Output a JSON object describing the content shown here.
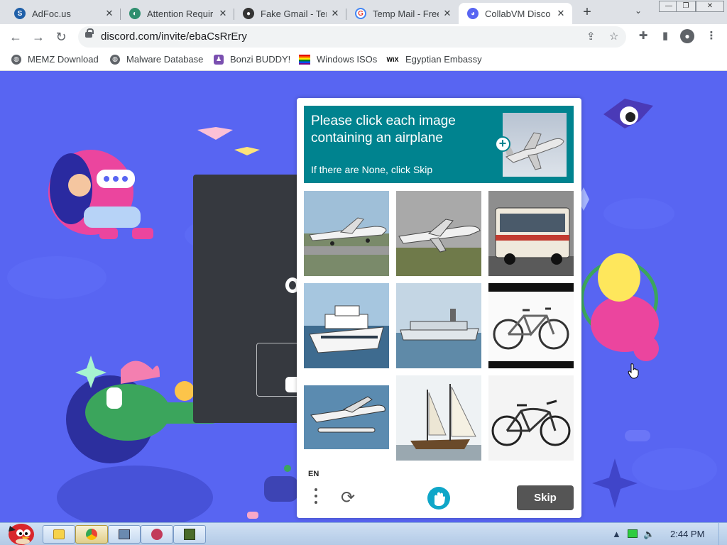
{
  "browser": {
    "tabs": [
      {
        "title": "AdFoc.us",
        "icon": "adfocus-icon",
        "active": false
      },
      {
        "title": "Attention Requir",
        "icon": "cloudflare-icon",
        "active": false
      },
      {
        "title": "Fake Gmail - Ter",
        "icon": "spy-icon",
        "active": false
      },
      {
        "title": "Temp Mail - Free",
        "icon": "google-icon",
        "active": false
      },
      {
        "title": "CollabVM Disco",
        "icon": "discord-icon",
        "active": true
      }
    ],
    "new_tab": "+",
    "tab_search": "⌄",
    "url": "discord.com/invite/ebaCsRrEry",
    "bookmarks": [
      {
        "label": "MEMZ Download",
        "icon": "globe-icon"
      },
      {
        "label": "Malware Database",
        "icon": "globe-icon"
      },
      {
        "label": "Bonzi BUDDY!",
        "icon": "bonzi-icon"
      },
      {
        "label": "Windows ISOs",
        "icon": "rainbow-flag-icon"
      },
      {
        "label": "Egyptian Embassy",
        "icon": "wix-icon",
        "icon_text": "WiX"
      }
    ]
  },
  "captcha": {
    "prompt": "Please click each image containing an airplane",
    "sub": "If there are None, click Skip",
    "sample_plus": "+",
    "images": [
      {
        "subject": "airplane"
      },
      {
        "subject": "airplane"
      },
      {
        "subject": "bus"
      },
      {
        "subject": "boat"
      },
      {
        "subject": "boat"
      },
      {
        "subject": "bicycle"
      },
      {
        "subject": "seaplane"
      },
      {
        "subject": "sailboat"
      },
      {
        "subject": "bicycle"
      }
    ],
    "language": "EN",
    "refresh": "⟳",
    "skip_label": "Skip"
  },
  "taskbar": {
    "time": "2:44 PM"
  },
  "colors": {
    "discord_blurple": "#5865f2",
    "captcha_header": "#00838f",
    "skip_button": "#555555"
  }
}
